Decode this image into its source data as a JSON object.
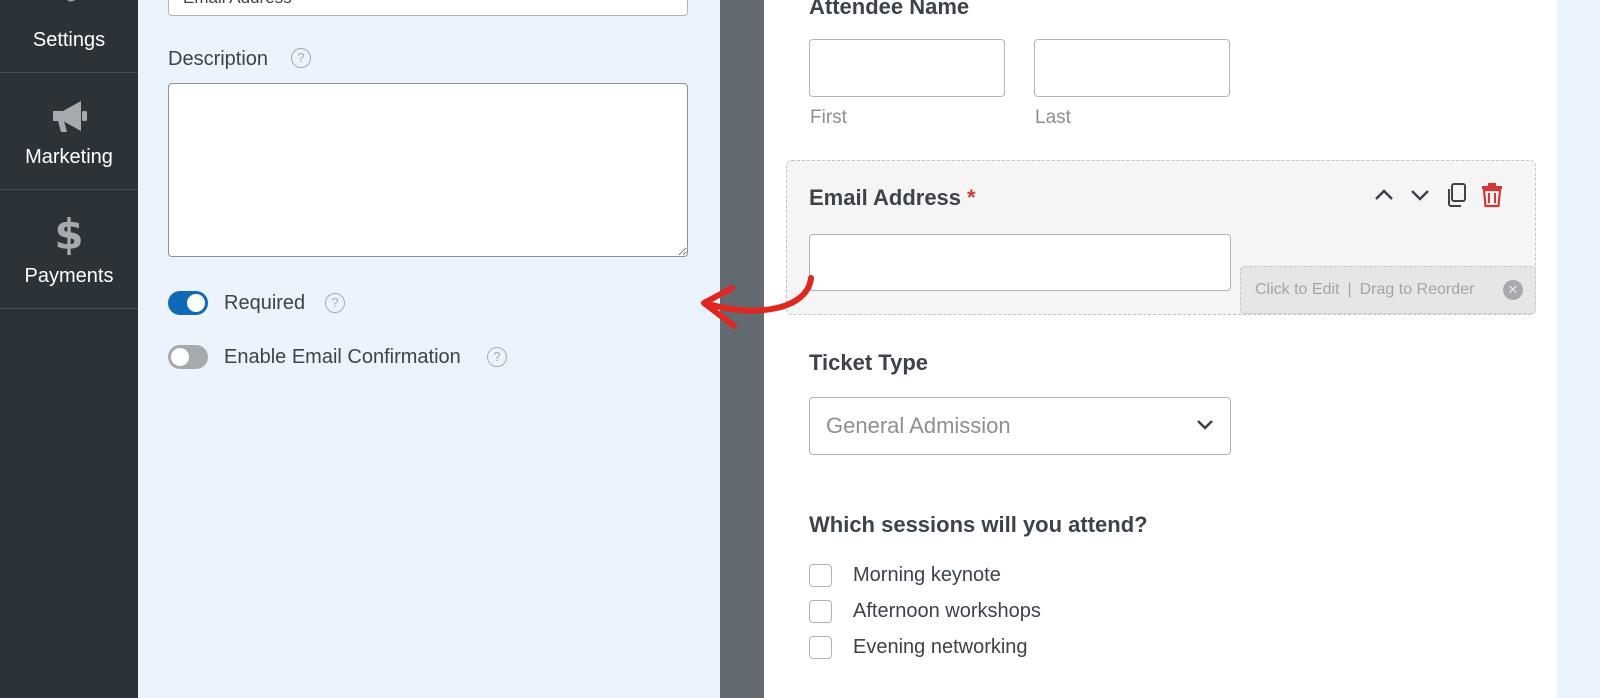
{
  "nav": {
    "items": [
      {
        "label": "Settings",
        "icon": "sliders-icon"
      },
      {
        "label": "Marketing",
        "icon": "megaphone-icon"
      },
      {
        "label": "Payments",
        "icon": "dollar-icon"
      }
    ]
  },
  "options_panel": {
    "label_field_value": "Email Address",
    "description_label": "Description",
    "description_value": "",
    "required_label": "Required",
    "required_on": true,
    "email_confirmation_label": "Enable Email Confirmation",
    "email_confirmation_on": false,
    "help_glyph": "?"
  },
  "preview": {
    "attendee_label": "Attendee Name",
    "first_sublabel": "First",
    "last_sublabel": "Last",
    "email_label": "Email Address",
    "required_marker": "*",
    "edit_hint_click": "Click to Edit",
    "edit_hint_separator": "|",
    "edit_hint_drag": "Drag to Reorder",
    "ticket_label": "Ticket Type",
    "ticket_selected": "General Admission",
    "sessions_label": "Which sessions will you attend?",
    "sessions": [
      "Morning keynote",
      "Afternoon workshops",
      "Evening networking"
    ]
  },
  "colors": {
    "nav_bg": "#2c3338",
    "panel_bg": "#ebf3fc",
    "toggle_on": "#0e6ab9",
    "delete_red": "#d63638",
    "arrow_red": "#e0271f"
  }
}
